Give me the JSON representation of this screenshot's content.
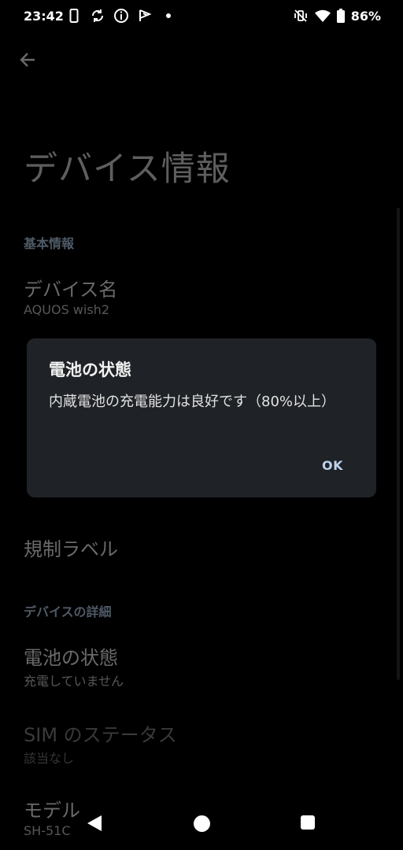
{
  "status_bar": {
    "time": "23:42",
    "left_icons": [
      "phone-icon",
      "sync-icon",
      "info-icon",
      "flag-icon",
      "dot-icon"
    ],
    "right_icons": [
      "mute-vibrate-icon",
      "wifi-icon",
      "battery-icon"
    ],
    "battery_percent": "86%"
  },
  "page": {
    "back_icon": "arrow-back-icon",
    "title": "デバイス情報",
    "sections": {
      "basic_info": "基本情報",
      "device_details": "デバイスの詳細"
    },
    "items": {
      "device_name": {
        "title": "デバイス名",
        "subtitle": "AQUOS wish2"
      },
      "regulatory_label": {
        "title": "規制ラベル"
      },
      "battery_status": {
        "title": "電池の状態",
        "subtitle": "充電していません"
      },
      "sim_status": {
        "title": "SIM のステータス",
        "subtitle": "該当なし"
      },
      "model": {
        "title": "モデル",
        "subtitle": "SH-51C"
      }
    }
  },
  "dialog": {
    "title": "電池の状態",
    "body": "内蔵電池の充電能力は良好です（80%以上）",
    "ok_label": "OK"
  },
  "nav_bar": {
    "icons": [
      "nav-back-icon",
      "nav-home-icon",
      "nav-recents-icon"
    ]
  },
  "colors": {
    "background": "#000000",
    "dialog_bg": "#1f2226",
    "accent": "#bcd2ee"
  }
}
